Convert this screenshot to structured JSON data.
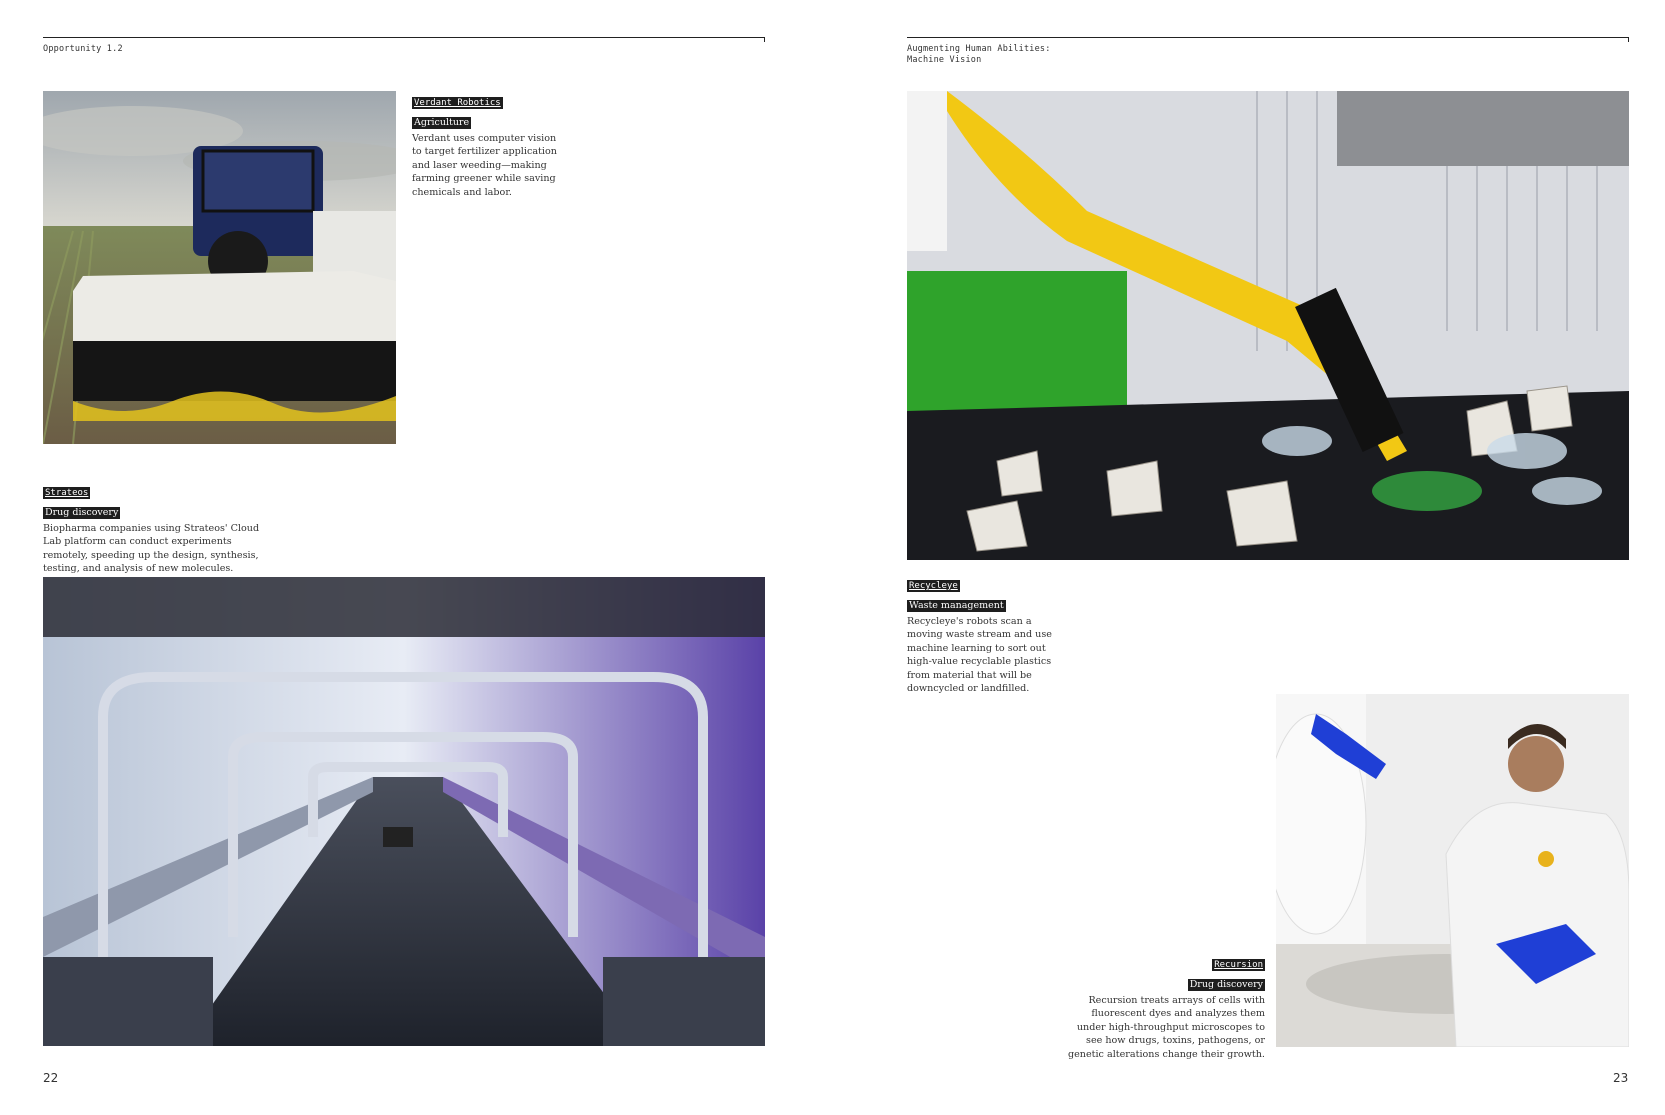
{
  "left_page": {
    "header": "Opportunity 1.2",
    "page_number": "22",
    "verdant": {
      "company": "Verdant Robotics",
      "sector": "Agriculture",
      "description": "Verdant uses computer vision to target fertilizer application and laser weeding—making farming greener while saving chemicals and labor."
    },
    "strateos": {
      "company": "Strateos",
      "sector": "Drug discovery",
      "description": "Biopharma companies using Strateos' Cloud Lab platform can conduct experiments remotely, speeding up the design, synthesis, testing, and analysis of new molecules."
    }
  },
  "right_page": {
    "header_line1": "Augmenting Human Abilities:",
    "header_line2": "Machine Vision",
    "page_number": "23",
    "recycleye": {
      "company": "Recycleye",
      "sector": "Waste management",
      "description": "Recycleye's robots scan a moving waste stream and use machine learning to sort out high-value recyclable plastics from material that will be downcycled or landfilled."
    },
    "recursion": {
      "company": "Recursion",
      "sector": "Drug discovery",
      "description": "Recursion treats arrays of cells with fluorescent dyes and analyzes them under high-throughput microscopes to see how drugs, toxins, pathogens, or genetic alterations change their growth."
    }
  }
}
